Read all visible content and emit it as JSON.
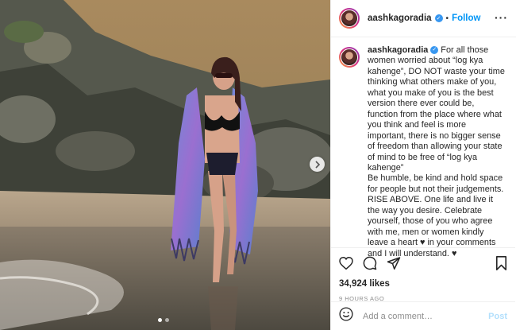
{
  "post": {
    "username": "aashkagoradia",
    "separator": "•",
    "follow_label": "Follow",
    "more_icon": "more-horizontal-icon",
    "caption_user": "aashkagoradia",
    "caption_text": " For all those women worried about “log kya kahenge”, DO NOT waste your time thinking what others make of you, what you make of you is the best version there ever could be, function from the place where what you think and feel is more important, there is no bigger sense of freedom than allowing your state of mind to be free of “log kya kahenge”\nBe humble, be kind and hold space for people but not their judgements. RISE ABOVE. One life and live it the way you desire. Celebrate yourself, those of you who agree with me, men or women kindly leave a heart ♥ in your comments and I will understand. ♥",
    "likes": "34,924 likes",
    "time": "9 HOURS AGO"
  },
  "comment": {
    "placeholder": "Add a comment…",
    "post_label": "Post"
  },
  "carousel": {
    "slides": 2,
    "current": 1
  },
  "colors": {
    "accent": "#0095f6",
    "verified": "#3897f0",
    "post_disabled": "#b2dffc",
    "muted": "#8e8e8e"
  }
}
